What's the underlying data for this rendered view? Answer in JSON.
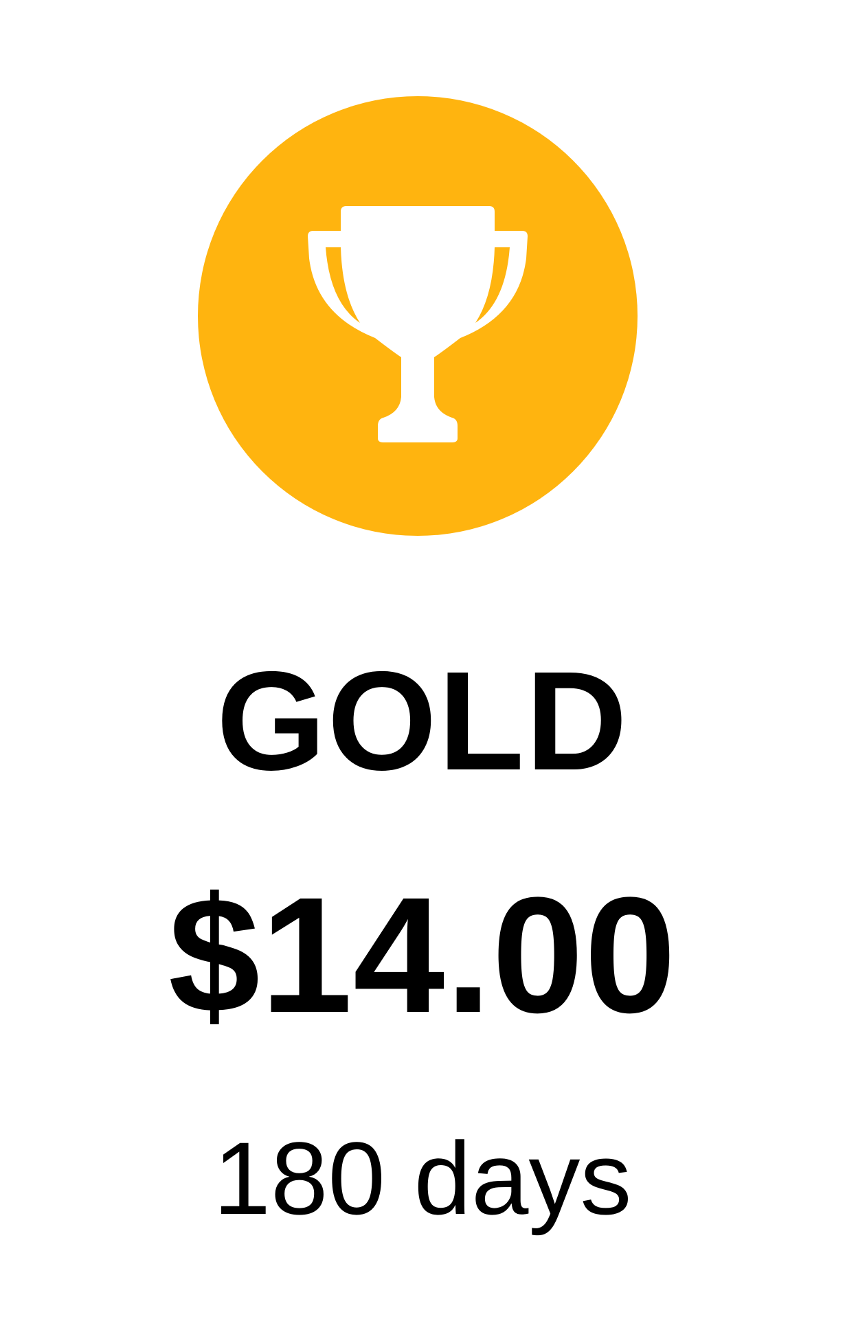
{
  "plan": {
    "tier_name": "GOLD",
    "price": "$14.00",
    "duration": "180 days",
    "icon": "trophy-icon",
    "badge_color": "#FFB40F",
    "icon_color": "#FFFFFF"
  }
}
